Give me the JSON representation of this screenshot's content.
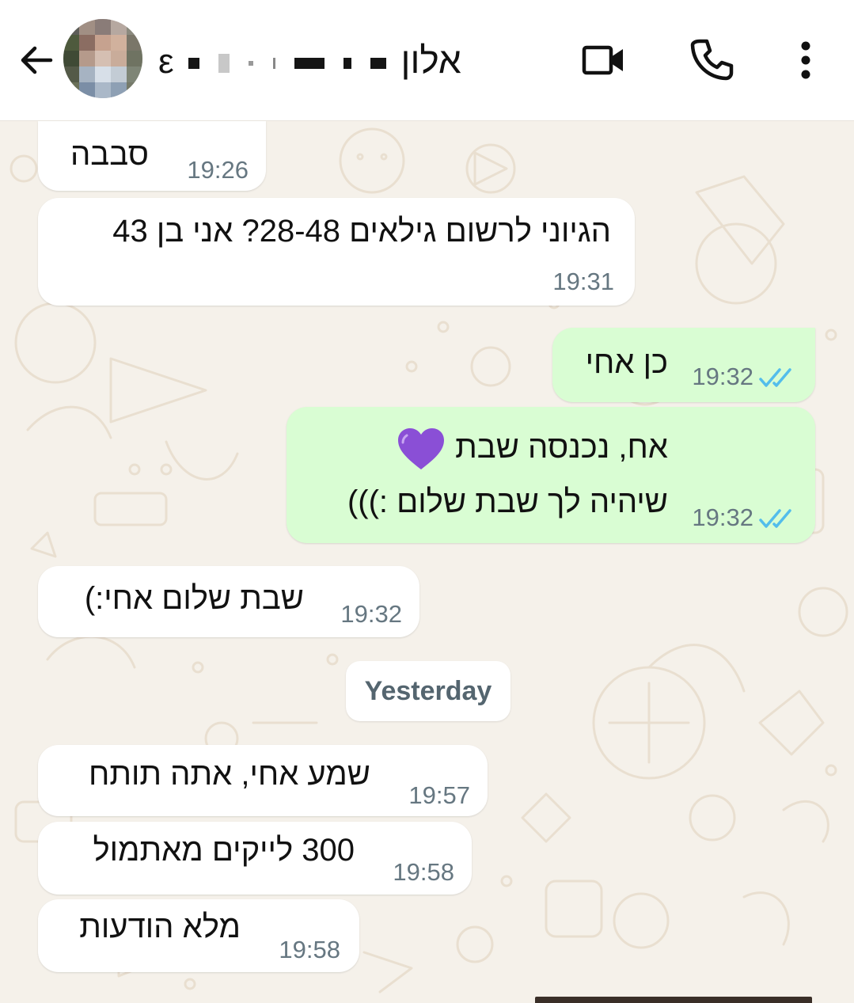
{
  "header": {
    "contact_name": "אלון",
    "contact_name_tail": "ε",
    "icons": {
      "back": "arrow-left-icon",
      "video": "video-camera-icon",
      "call": "phone-icon",
      "menu": "more-vertical-icon"
    }
  },
  "messages": [
    {
      "direction": "incoming",
      "text": "סבבה",
      "time": "19:26"
    },
    {
      "direction": "incoming",
      "text": "הגיוני לרשום גילאים 28-48? אני בן 43",
      "time": "19:31"
    },
    {
      "direction": "outgoing",
      "text": "כן אחי",
      "time": "19:32",
      "status": "read"
    },
    {
      "direction": "outgoing",
      "lines": [
        "אח, נכנסה שבת",
        "שיהיה לך שבת שלום :)))"
      ],
      "emoji": "purple-heart",
      "time": "19:32",
      "status": "read"
    },
    {
      "direction": "incoming",
      "text": "שבת שלום אחי:)",
      "time": "19:32"
    },
    {
      "direction": "incoming",
      "text": "שמע אחי, אתה תותח",
      "time": "19:57"
    },
    {
      "direction": "incoming",
      "text": "300 לייקים מאתמול",
      "time": "19:58"
    },
    {
      "direction": "incoming",
      "text": "מלא הודעות",
      "time": "19:58"
    }
  ],
  "date_separator": "Yesterday",
  "colors": {
    "header_bg": "#ffffff",
    "chat_bg": "#f5f1ea",
    "incoming_bubble": "#ffffff",
    "outgoing_bubble": "#d9fdd3",
    "read_ticks": "#53bdeb",
    "time_text": "#667781"
  }
}
